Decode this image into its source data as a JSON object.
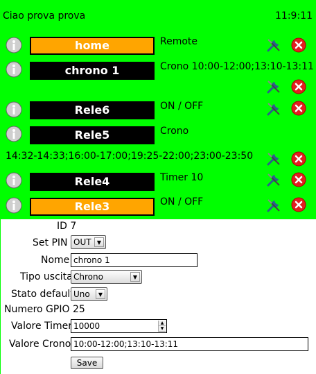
{
  "header": {
    "user": "Ciao prova prova",
    "time": "11:9:11"
  },
  "devices": [
    {
      "name": "home",
      "status": "Remote",
      "active": true
    },
    {
      "name": "chrono 1",
      "status": "Crono  10:00-12:00;13:10-13:11",
      "active": false
    },
    {
      "name": "Rele6",
      "status": "ON / OFF",
      "active": false
    },
    {
      "name": "Rele5",
      "status": "Crono",
      "active": false
    },
    {
      "name": "Rele4",
      "status": "Timer  10",
      "active": false
    },
    {
      "name": "Rele3",
      "status": "ON / OFF",
      "active": true
    }
  ],
  "rele5_schedule": "14:32-14:33;16:00-17:00;19:25-22:00;23:00-23:50",
  "form": {
    "id_label": "ID",
    "id_value": "7",
    "set_pin_label": "Set PIN",
    "set_pin_value": "OUT",
    "nome_label": "Nome",
    "nome_value": "chrono 1",
    "tipo_label": "Tipo uscita",
    "tipo_value": "Chrono",
    "stato_label": "Stato default",
    "stato_value": "Uno",
    "gpio_label": "Numero GPIO",
    "gpio_value": "25",
    "timer_label": "Valore Timer",
    "timer_value": "10000",
    "crono_label": "Valore Crono",
    "crono_value": "10:00-12:00;13:10-13:11",
    "save_label": "Save"
  },
  "icons": {
    "info": "info-icon",
    "settings": "wrench-screwdriver-icon",
    "delete": "delete-icon"
  },
  "colors": {
    "background": "#00ff00",
    "active": "#ffa500",
    "button": "#000000",
    "delete": "#e02020"
  }
}
